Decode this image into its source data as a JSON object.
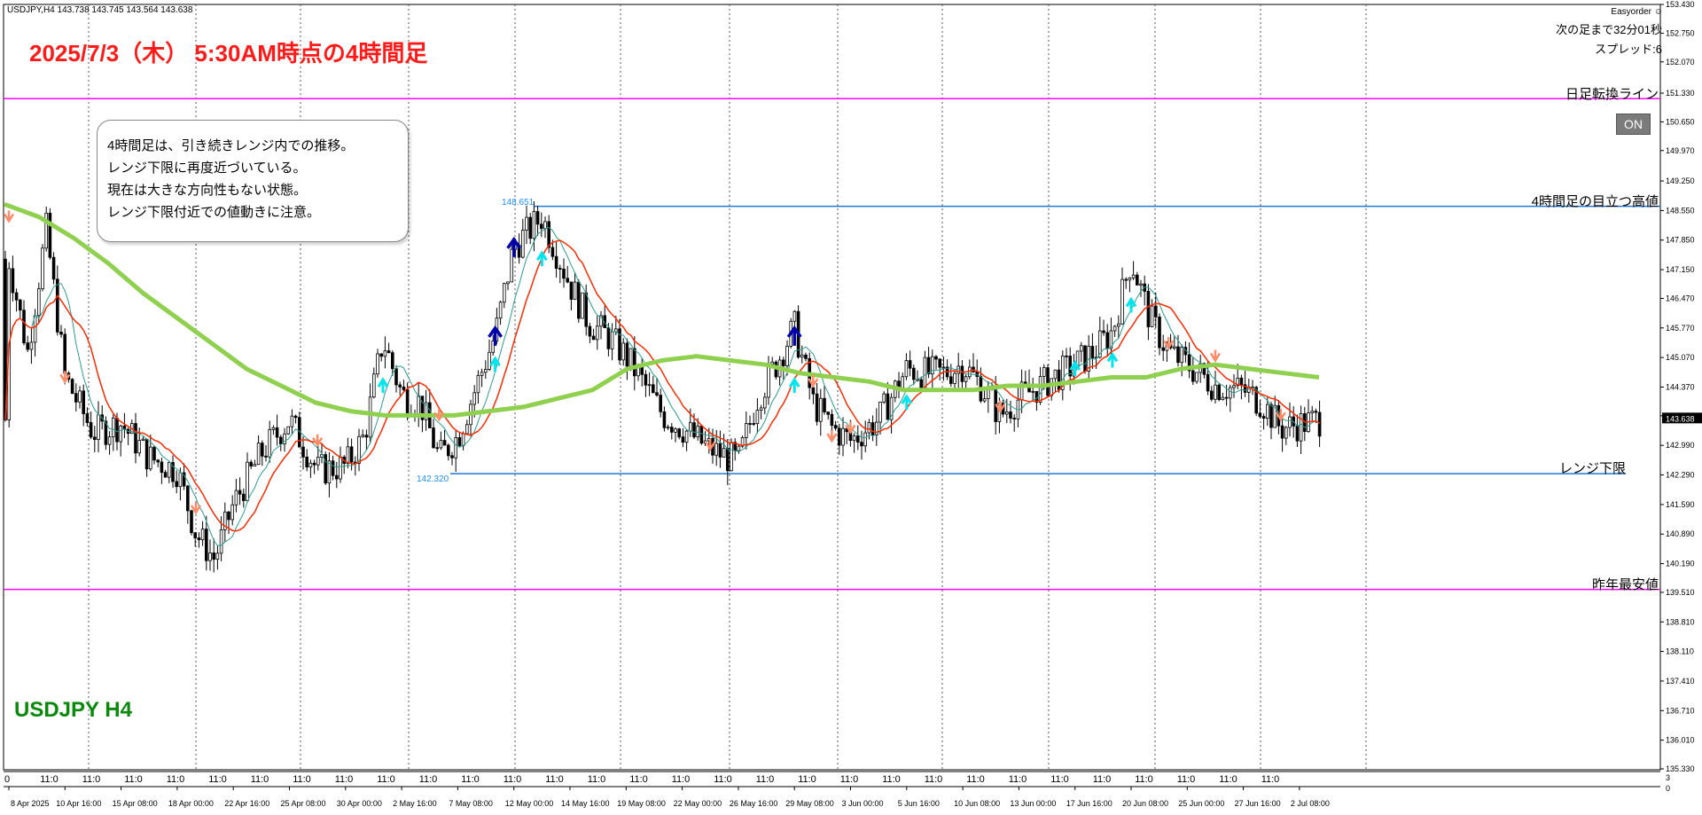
{
  "header": {
    "symbol_info": "USDJPY,H4  143.738 143.745 143.564 143.638",
    "title": "2025/7/3（木） 5:30AM時点の4時間足",
    "symbol_label": "USDJPY H4"
  },
  "note": {
    "lines": [
      "4時間足は、引き続きレンジ内での推移。",
      "レンジ下限に再度近づいている。",
      "現在は大きな方向性もない状態。",
      "レンジ下限付近での値動きに注意。"
    ]
  },
  "panel": {
    "easyorder": "Easyorder ☺",
    "next_bar": "次の足まで32分01秒",
    "spread": "スプレッド:6",
    "on_button": "ON"
  },
  "colors": {
    "bull_candle": "#000000",
    "bear_candle": "#000000",
    "magenta_line": "#ff00ff",
    "blue_line": "#1e78d4",
    "ma_green": "#8fd14f",
    "ma_red": "#ff2a00",
    "ma_teal": "#2a9d8f",
    "arrow_up": "#0000aa",
    "arrow_up_light": "#00e5ee",
    "arrow_down": "#ff8c69",
    "current_price_bg": "#000000"
  },
  "chart_data": {
    "type": "candlestick",
    "symbol": "USDJPY",
    "timeframe": "H4",
    "ylim": [
      135.33,
      153.43
    ],
    "y_ticks": [
      153.43,
      152.75,
      152.07,
      151.33,
      150.65,
      149.97,
      149.25,
      148.55,
      147.85,
      147.15,
      146.47,
      145.77,
      145.07,
      144.37,
      143.69,
      142.99,
      142.29,
      141.59,
      140.89,
      140.19,
      139.51,
      138.81,
      138.11,
      137.41,
      136.71,
      136.01,
      135.33
    ],
    "x_tick_labels": [
      "8 Apr 2025",
      "10 Apr 16:00",
      "15 Apr 08:00",
      "18 Apr 00:00",
      "22 Apr 16:00",
      "25 Apr 08:00",
      "30 Apr 00:00",
      "2 May 16:00",
      "7 May 08:00",
      "12 May 00:00",
      "14 May 16:00",
      "19 May 08:00",
      "22 May 00:00",
      "26 May 16:00",
      "29 May 08:00",
      "3 Jun 00:00",
      "5 Jun 16:00",
      "10 Jun 08:00",
      "13 Jun 00:00",
      "17 Jun 16:00",
      "20 Jun 08:00",
      "25 Jun 00:00",
      "27 Jun 16:00",
      "2 Jul 08:00"
    ],
    "time_marks": [
      "0",
      "11:0",
      "11:0",
      "11:0",
      "11:0",
      "11:0",
      "11:0",
      "11:0",
      "11:0",
      "11:0",
      "11:0",
      "11:0",
      "11:0",
      "11:0",
      "11:0",
      "11:0",
      "11:0",
      "11:0",
      "11:0",
      "11:0",
      "11:0",
      "11:0",
      "11:0",
      "11:0",
      "11:0",
      "11:0",
      "11:0",
      "11:0",
      "11:0",
      "11:0",
      "11:0"
    ],
    "sub_axis_labels": [
      "3",
      "0"
    ],
    "horizontal_lines": [
      {
        "label": "日足転換ライン",
        "price": 151.2,
        "color": "magenta"
      },
      {
        "label": "4時間足の目立つ高値",
        "price": 148.651,
        "price_label": "148.651",
        "color": "blue"
      },
      {
        "label": "レンジ下限",
        "price": 142.32,
        "price_label": "142.320",
        "color": "blue"
      },
      {
        "label": "昨年最安値",
        "price": 139.58,
        "color": "magenta"
      }
    ],
    "current_price": 143.638,
    "price_path": [
      {
        "t": "8 Apr 2025",
        "price": 147.4
      },
      {
        "t": "9 Apr",
        "price": 145.2
      },
      {
        "t": "10 Apr 00:00",
        "price": 148.1
      },
      {
        "t": "10 Apr 16:00",
        "price": 144.6
      },
      {
        "t": "11 Apr",
        "price": 143.3
      },
      {
        "t": "15 Apr 08:00",
        "price": 143.5
      },
      {
        "t": "17 Apr",
        "price": 142.7
      },
      {
        "t": "18 Apr 00:00",
        "price": 142.4
      },
      {
        "t": "21 Apr",
        "price": 140.9
      },
      {
        "t": "22 Apr 00:00",
        "price": 140.3
      },
      {
        "t": "22 Apr 16:00",
        "price": 141.6
      },
      {
        "t": "24 Apr",
        "price": 142.8
      },
      {
        "t": "25 Apr 08:00",
        "price": 143.6
      },
      {
        "t": "28 Apr",
        "price": 142.4
      },
      {
        "t": "30 Apr 00:00",
        "price": 142.5
      },
      {
        "t": "1 May",
        "price": 143.2
      },
      {
        "t": "2 May 00:00",
        "price": 145.5
      },
      {
        "t": "2 May 16:00",
        "price": 144.2
      },
      {
        "t": "5 May",
        "price": 144.0
      },
      {
        "t": "6 May",
        "price": 142.7
      },
      {
        "t": "7 May 08:00",
        "price": 143.2
      },
      {
        "t": "8 May",
        "price": 144.4
      },
      {
        "t": "9 May",
        "price": 145.6
      },
      {
        "t": "12 May 00:00",
        "price": 147.7
      },
      {
        "t": "13 May",
        "price": 148.4
      },
      {
        "t": "14 May 16:00",
        "price": 146.8
      },
      {
        "t": "15 May",
        "price": 145.9
      },
      {
        "t": "16 May",
        "price": 145.6
      },
      {
        "t": "19 May 08:00",
        "price": 145.1
      },
      {
        "t": "20 May",
        "price": 144.4
      },
      {
        "t": "21 May",
        "price": 143.7
      },
      {
        "t": "22 May 00:00",
        "price": 143.4
      },
      {
        "t": "23 May",
        "price": 142.9
      },
      {
        "t": "26 May 16:00",
        "price": 142.6
      },
      {
        "t": "27 May",
        "price": 144.1
      },
      {
        "t": "28 May",
        "price": 144.9
      },
      {
        "t": "29 May 08:00",
        "price": 145.8
      },
      {
        "t": "30 May",
        "price": 144.0
      },
      {
        "t": "2 Jun",
        "price": 143.4
      },
      {
        "t": "3 Jun 00:00",
        "price": 143.1
      },
      {
        "t": "4 Jun",
        "price": 143.6
      },
      {
        "t": "5 Jun 16:00",
        "price": 144.8
      },
      {
        "t": "6 Jun",
        "price": 144.7
      },
      {
        "t": "9 Jun",
        "price": 144.7
      },
      {
        "t": "10 Jun 08:00",
        "price": 144.9
      },
      {
        "t": "11 Jun",
        "price": 144.4
      },
      {
        "t": "12 Jun",
        "price": 143.7
      },
      {
        "t": "13 Jun 00:00",
        "price": 144.1
      },
      {
        "t": "16 Jun",
        "price": 144.5
      },
      {
        "t": "17 Jun 16:00",
        "price": 144.9
      },
      {
        "t": "18 Jun",
        "price": 145.2
      },
      {
        "t": "19 Jun",
        "price": 145.7
      },
      {
        "t": "20 Jun 08:00",
        "price": 147.4
      },
      {
        "t": "23 Jun",
        "price": 146.0
      },
      {
        "t": "24 Jun",
        "price": 145.2
      },
      {
        "t": "25 Jun 00:00",
        "price": 144.9
      },
      {
        "t": "26 Jun",
        "price": 144.4
      },
      {
        "t": "27 Jun 16:00",
        "price": 144.3
      },
      {
        "t": "30 Jun",
        "price": 144.0
      },
      {
        "t": "1 Jul",
        "price": 143.4
      },
      {
        "t": "2 Jul 08:00",
        "price": 143.6
      }
    ],
    "ma_long_path": [
      148.7,
      148.4,
      147.9,
      147.3,
      146.6,
      146.0,
      145.4,
      144.8,
      144.4,
      144.0,
      143.8,
      143.7,
      143.7,
      143.7,
      143.8,
      143.9,
      144.1,
      144.3,
      144.8,
      145.0,
      145.1,
      145.0,
      144.9,
      144.7,
      144.6,
      144.5,
      144.3,
      144.3,
      144.3,
      144.4,
      144.4,
      144.5,
      144.6,
      144.6,
      144.8,
      144.9,
      144.8,
      144.7,
      144.6
    ],
    "signals": [
      {
        "t": "8 Apr 2025",
        "price": 148.3,
        "type": "down"
      },
      {
        "t": "10 Apr 16:00",
        "price": 144.5,
        "type": "down"
      },
      {
        "t": "21 Apr",
        "price": 141.4,
        "type": "down"
      },
      {
        "t": "28 Apr",
        "price": 143.0,
        "type": "down"
      },
      {
        "t": "2 May 00:00",
        "price": 144.4,
        "type": "up_light"
      },
      {
        "t": "6 May",
        "price": 143.6,
        "type": "down"
      },
      {
        "t": "9 May",
        "price": 145.6,
        "type": "up"
      },
      {
        "t": "9 May",
        "price": 144.9,
        "type": "up_light"
      },
      {
        "t": "12 May 00:00",
        "price": 147.7,
        "type": "up"
      },
      {
        "t": "13 May",
        "price": 147.4,
        "type": "up_light"
      },
      {
        "t": "23 May",
        "price": 142.9,
        "type": "down"
      },
      {
        "t": "29 May 08:00",
        "price": 145.6,
        "type": "up"
      },
      {
        "t": "29 May 08:00",
        "price": 144.4,
        "type": "up_light"
      },
      {
        "t": "30 May",
        "price": 144.4,
        "type": "down"
      },
      {
        "t": "2 Jun",
        "price": 143.1,
        "type": "down"
      },
      {
        "t": "3 Jun 00:00",
        "price": 143.3,
        "type": "down"
      },
      {
        "t": "5 Jun 16:00",
        "price": 144.0,
        "type": "up_light"
      },
      {
        "t": "12 Jun",
        "price": 143.8,
        "type": "down"
      },
      {
        "t": "17 Jun 16:00",
        "price": 144.8,
        "type": "up_light"
      },
      {
        "t": "19 Jun",
        "price": 145.0,
        "type": "up_light"
      },
      {
        "t": "20 Jun 08:00",
        "price": 146.3,
        "type": "up_light"
      },
      {
        "t": "24 Jun",
        "price": 145.3,
        "type": "down"
      },
      {
        "t": "26 Jun",
        "price": 145.0,
        "type": "down"
      },
      {
        "t": "1 Jul",
        "price": 143.6,
        "type": "down"
      }
    ]
  }
}
